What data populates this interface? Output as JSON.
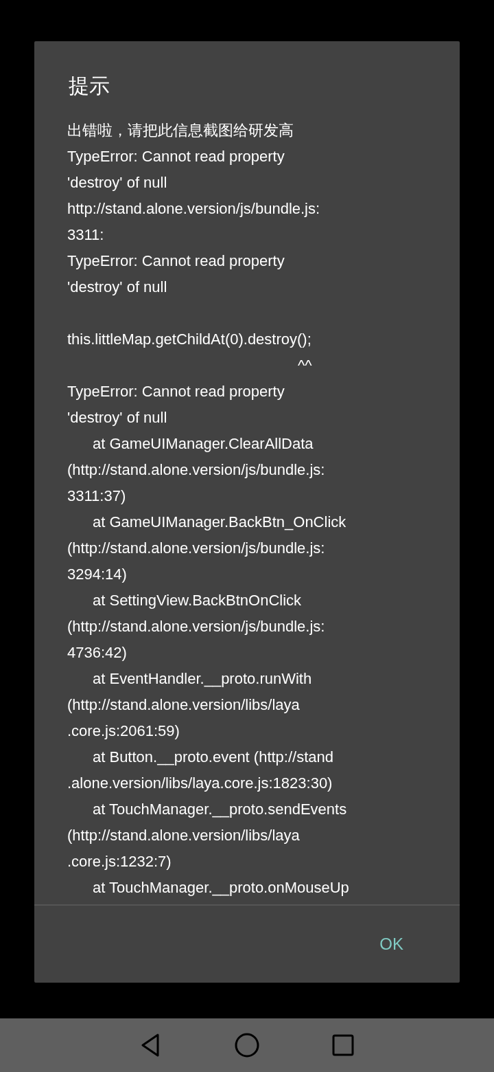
{
  "dialog": {
    "title": "提示",
    "message_lines": [
      {
        "kind": "plain",
        "text": "出错啦，请把此信息截图给研发高"
      },
      {
        "kind": "plain",
        "text": "TypeError: Cannot read property"
      },
      {
        "kind": "plain",
        "text": "'destroy' of null"
      },
      {
        "kind": "plain",
        "text": "http://stand.alone.version/js/bundle.js:"
      },
      {
        "kind": "plain",
        "text": "3311:"
      },
      {
        "kind": "plain",
        "text": "TypeError: Cannot read property"
      },
      {
        "kind": "plain",
        "text": "'destroy' of null"
      },
      {
        "kind": "gap"
      },
      {
        "kind": "plain",
        "text": "this.littleMap.getChildAt(0).destroy();"
      },
      {
        "kind": "caret",
        "text": "^^"
      },
      {
        "kind": "plain",
        "text": "TypeError: Cannot read property"
      },
      {
        "kind": "plain",
        "text": "'destroy' of null"
      },
      {
        "kind": "frame",
        "text": "at GameUIManager.ClearAllData"
      },
      {
        "kind": "plain",
        "text": "(http://stand.alone.version/js/bundle.js:"
      },
      {
        "kind": "plain",
        "text": "3311:37)"
      },
      {
        "kind": "frame",
        "text": "at GameUIManager.BackBtn_OnClick"
      },
      {
        "kind": "plain",
        "text": "(http://stand.alone.version/js/bundle.js:"
      },
      {
        "kind": "plain",
        "text": "3294:14)"
      },
      {
        "kind": "frame",
        "text": "at SettingView.BackBtnOnClick"
      },
      {
        "kind": "plain",
        "text": "(http://stand.alone.version/js/bundle.js:"
      },
      {
        "kind": "plain",
        "text": "4736:42)"
      },
      {
        "kind": "frame",
        "text": "at EventHandler.__proto.runWith"
      },
      {
        "kind": "plain",
        "text": "(http://stand.alone.version/libs/laya"
      },
      {
        "kind": "plain",
        "text": ".core.js:2061:59)"
      },
      {
        "kind": "frame",
        "text": "at Button.__proto.event (http://stand"
      },
      {
        "kind": "plain",
        "text": ".alone.version/libs/laya.core.js:1823:30)"
      },
      {
        "kind": "frame",
        "text": "at TouchManager.__proto.sendEvents"
      },
      {
        "kind": "plain",
        "text": "(http://stand.alone.version/libs/laya"
      },
      {
        "kind": "plain",
        "text": ".core.js:1232:7)"
      },
      {
        "kind": "frame",
        "text": "at TouchManager.__proto.onMouseUp"
      }
    ],
    "button": "OK"
  }
}
